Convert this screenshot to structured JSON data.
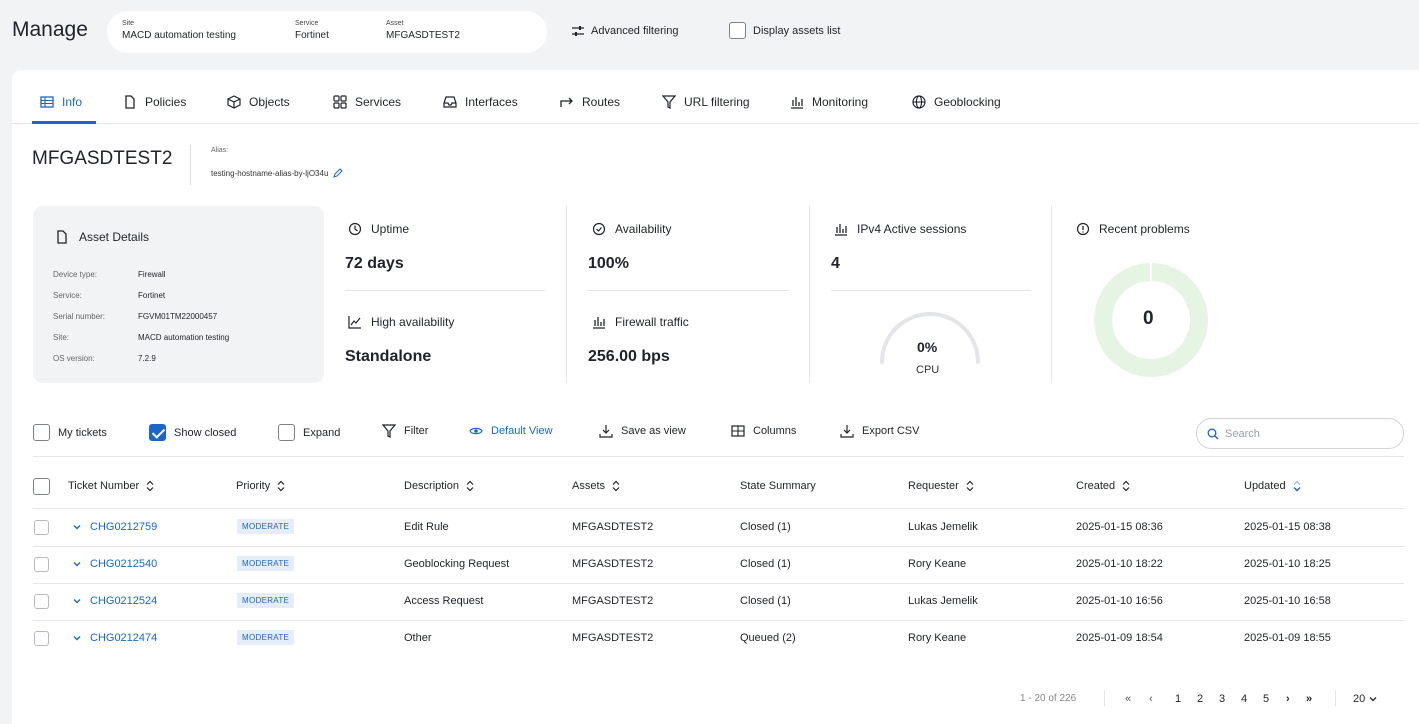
{
  "header": {
    "title": "Manage",
    "site_label": "Site",
    "site_value": "MACD automation testing",
    "service_label": "Service",
    "service_value": "Fortinet",
    "asset_label": "Asset",
    "asset_value": "MFGASDTEST2",
    "advanced_filtering": "Advanced filtering",
    "display_assets_list": "Display assets list",
    "display_assets_checked": false
  },
  "tabs": [
    {
      "label": "Info",
      "icon": "info-icon",
      "active": true
    },
    {
      "label": "Policies",
      "icon": "document-icon"
    },
    {
      "label": "Objects",
      "icon": "cube-icon"
    },
    {
      "label": "Services",
      "icon": "grid-icon"
    },
    {
      "label": "Interfaces",
      "icon": "inbox-icon"
    },
    {
      "label": "Routes",
      "icon": "arrow-icon"
    },
    {
      "label": "URL filtering",
      "icon": "funnel-icon"
    },
    {
      "label": "Monitoring",
      "icon": "bar-chart-icon"
    },
    {
      "label": "Geoblocking",
      "icon": "globe-icon"
    }
  ],
  "asset": {
    "name": "MFGASDTEST2",
    "alias_label": "Alias:",
    "alias_value": "testing-hostname-alias-by-ljO34u"
  },
  "details": {
    "title": "Asset Details",
    "rows": [
      {
        "key": "Device type:",
        "value": "Firewall"
      },
      {
        "key": "Service:",
        "value": "Fortinet"
      },
      {
        "key": "Serial number:",
        "value": "FGVM01TM22000457"
      },
      {
        "key": "Site:",
        "value": "MACD automation testing"
      },
      {
        "key": "OS version:",
        "value": "7.2.9"
      }
    ]
  },
  "metrics": {
    "uptime_label": "Uptime",
    "uptime_value": "72 days",
    "ha_label": "High availability",
    "ha_value": "Standalone",
    "availability_label": "Availability",
    "availability_value": "100%",
    "traffic_label": "Firewall traffic",
    "traffic_value": "256.00 bps",
    "sessions_label": "IPv4 Active sessions",
    "sessions_value": "4",
    "cpu_value": "0%",
    "cpu_fraction": 0,
    "cpu_label": "CPU",
    "problems_label": "Recent problems",
    "problems_value": "0"
  },
  "toolbar": {
    "my_tickets": "My tickets",
    "show_closed": "Show closed",
    "expand": "Expand",
    "filter": "Filter",
    "default_view": "Default View",
    "save_as_view": "Save as view",
    "columns": "Columns",
    "export_csv": "Export CSV",
    "search_placeholder": "Search"
  },
  "table": {
    "headers": [
      "Ticket Number",
      "Priority",
      "Description",
      "Assets",
      "State Summary",
      "Requester",
      "Created",
      "Updated"
    ],
    "rows": [
      {
        "ticket": "CHG0212759",
        "priority": "MODERATE",
        "description": "Edit Rule",
        "asset": "MFGASDTEST2",
        "state": "Closed (1)",
        "requester": "Lukas Jemelik",
        "created": "2025-01-15 08:36",
        "updated": "2025-01-15 08:38"
      },
      {
        "ticket": "CHG0212540",
        "priority": "MODERATE",
        "description": "Geoblocking Request",
        "asset": "MFGASDTEST2",
        "state": "Closed (1)",
        "requester": "Rory Keane",
        "created": "2025-01-10 18:22",
        "updated": "2025-01-10 18:25"
      },
      {
        "ticket": "CHG0212524",
        "priority": "MODERATE",
        "description": "Access Request",
        "asset": "MFGASDTEST2",
        "state": "Closed (1)",
        "requester": "Lukas Jemelik",
        "created": "2025-01-10 16:56",
        "updated": "2025-01-10 16:58"
      },
      {
        "ticket": "CHG0212474",
        "priority": "MODERATE",
        "description": "Other",
        "asset": "MFGASDTEST2",
        "state": "Queued (2)",
        "requester": "Rory Keane",
        "created": "2025-01-09 18:54",
        "updated": "2025-01-09 18:55"
      }
    ]
  },
  "pagination": {
    "range": "1 - 20 of 226",
    "pages": [
      "1",
      "2",
      "3",
      "4",
      "5"
    ],
    "page_size": "20"
  },
  "colors": {
    "accent": "#1a66c9",
    "badge_bg": "#e4edf8",
    "donut": "#e6f4e4"
  }
}
